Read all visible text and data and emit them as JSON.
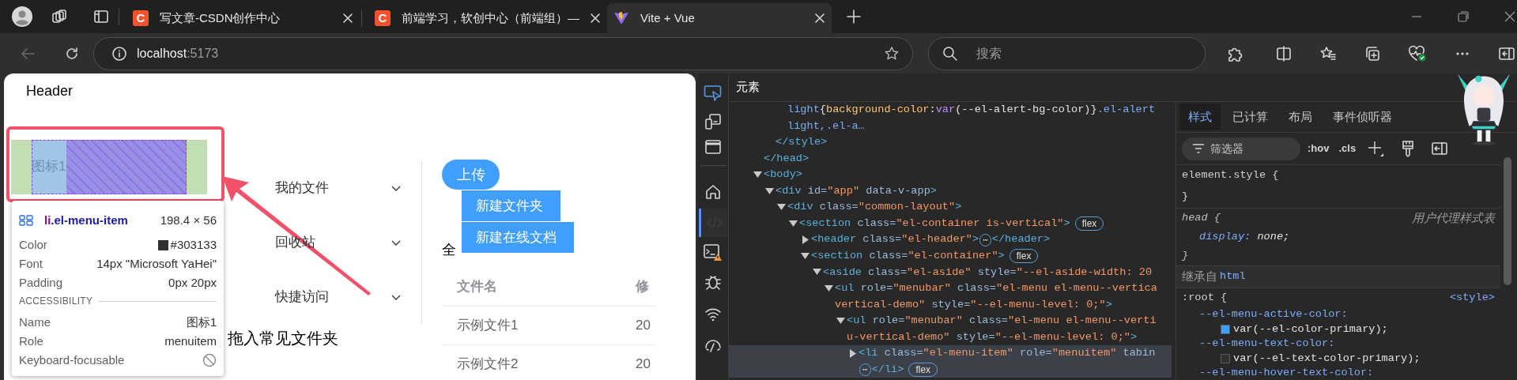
{
  "browser": {
    "tabs": [
      {
        "title": "写文章-CSDN创作中心",
        "kind": "letter",
        "icon_text": "C",
        "selected": false
      },
      {
        "title": "前端学习，软创中心（前端组）—",
        "kind": "letter",
        "icon_text": "C",
        "selected": false
      },
      {
        "title": "Vite + Vue",
        "kind": "vite",
        "selected": true
      }
    ],
    "back_disabled": true,
    "address": {
      "host": "localhost",
      "port": ":5173"
    },
    "search": {
      "placeholder": "搜索"
    }
  },
  "page": {
    "header": "Header",
    "inspected_item": {
      "label": "图标1"
    },
    "tooltip": {
      "tag": "li",
      "class_name": ".el-menu-item",
      "size": "198.4 × 56",
      "properties": [
        {
          "label": "Color",
          "value": "#303133",
          "color": "#303133"
        },
        {
          "label": "Font",
          "value": "14px \"Microsoft YaHei\""
        },
        {
          "label": "Padding",
          "value": "0px 20px"
        }
      ],
      "section": "ACCESSIBILITY",
      "accessibility": [
        {
          "label": "Name",
          "value": "图标1"
        },
        {
          "label": "Role",
          "value": "menuitem"
        },
        {
          "label": "Keyboard-focusable",
          "focusable": false
        }
      ]
    },
    "submenus": [
      {
        "label": "我的文件",
        "expanded": false
      },
      {
        "label": "回收站",
        "expanded": false
      },
      {
        "label": "快捷访问",
        "expanded": false
      }
    ],
    "drop_hint": "拖入常见文件夹",
    "upload_button": "上传",
    "dropdown": [
      "新建文件夹",
      "新建在线文档"
    ],
    "section_title": "全",
    "table": {
      "columns": [
        "文件名",
        "修"
      ],
      "rows": [
        [
          "示例文件1",
          "20"
        ],
        [
          "示例文件2",
          "20"
        ]
      ]
    }
  },
  "devtools": {
    "panel_title": "元素",
    "dom_tree": [
      {
        "children": [
          {
            "children": [
              {
                "lines": [
                  [
                    {
                      "kind": "selector",
                      "text": "light"
                    },
                    {
                      "kind": "plain",
                      "text": "{"
                    },
                    {
                      "kind": "property",
                      "text": "background-color"
                    },
                    {
                      "kind": "plain",
                      "text": ":"
                    },
                    {
                      "kind": "function",
                      "text": "var"
                    },
                    {
                      "kind": "plain",
                      "text": "(--el-alert-bg-color)}"
                    },
                    {
                      "kind": "selector",
                      "text": ".el-alert"
                    }
                  ],
                  [
                    {
                      "kind": "selector",
                      "text": "light,.el-a…"
                    }
                  ]
                ]
              }
            ]
          },
          {
            "lines": [
              [
                {
                  "kind": "tag",
                  "text": "</style>"
                }
              ]
            ]
          }
        ]
      },
      {
        "lines": [
          [
            {
              "kind": "tag",
              "text": "</head>"
            }
          ]
        ]
      },
      {
        "expanded": true,
        "lines": [
          [
            {
              "kind": "tag",
              "text": "<body>"
            }
          ]
        ],
        "children": [
          {
            "expanded": true,
            "lines": [
              [
                {
                  "kind": "tag",
                  "text": "<div"
                },
                {
                  "kind": "attr",
                  "text": " id="
                },
                {
                  "kind": "value",
                  "text": "\"app\""
                },
                {
                  "kind": "attr",
                  "text": " data-v-app"
                },
                {
                  "kind": "tag",
                  "text": ">"
                }
              ]
            ],
            "children": [
              {
                "expanded": true,
                "lines": [
                  [
                    {
                      "kind": "tag",
                      "text": "<div"
                    },
                    {
                      "kind": "attr",
                      "text": " class="
                    },
                    {
                      "kind": "value",
                      "text": "\"common-layout\""
                    },
                    {
                      "kind": "tag",
                      "text": ">"
                    }
                  ]
                ],
                "children": [
                  {
                    "expanded": true,
                    "badge": "flex",
                    "lines": [
                      [
                        {
                          "kind": "tag",
                          "text": "<section"
                        },
                        {
                          "kind": "attr",
                          "text": " class="
                        },
                        {
                          "kind": "value",
                          "text": "\"el-container is-vertical\""
                        },
                        {
                          "kind": "tag",
                          "text": ">"
                        }
                      ]
                    ],
                    "children": [
                      {
                        "expanded": false,
                        "lines": [
                          [
                            {
                              "kind": "tag",
                              "text": "<header"
                            },
                            {
                              "kind": "attr",
                              "text": " class="
                            },
                            {
                              "kind": "value",
                              "text": "\"el-header\""
                            },
                            {
                              "kind": "tag",
                              "text": ">"
                            },
                            {
                              "kind": "ellipsis",
                              "text": "⋯"
                            },
                            {
                              "kind": "tag",
                              "text": "</header>"
                            }
                          ]
                        ]
                      },
                      {
                        "expanded": true,
                        "badge": "flex",
                        "lines": [
                          [
                            {
                              "kind": "tag",
                              "text": "<section"
                            },
                            {
                              "kind": "attr",
                              "text": " class="
                            },
                            {
                              "kind": "value",
                              "text": "\"el-container\""
                            },
                            {
                              "kind": "tag",
                              "text": ">"
                            }
                          ]
                        ],
                        "children": [
                          {
                            "expanded": true,
                            "lines": [
                              [
                                {
                                  "kind": "tag",
                                  "text": "<aside"
                                },
                                {
                                  "kind": "attr",
                                  "text": " class="
                                },
                                {
                                  "kind": "value",
                                  "text": "\"el-aside\""
                                },
                                {
                                  "kind": "attr",
                                  "text": " style="
                                },
                                {
                                  "kind": "value",
                                  "text": "\"--el-aside-width: 20"
                                }
                              ]
                            ],
                            "children": [
                              {
                                "expanded": true,
                                "lines": [
                                  [
                                    {
                                      "kind": "tag",
                                      "text": "<ul"
                                    },
                                    {
                                      "kind": "attr",
                                      "text": " role="
                                    },
                                    {
                                      "kind": "value",
                                      "text": "\"menubar\""
                                    },
                                    {
                                      "kind": "attr",
                                      "text": " class="
                                    },
                                    {
                                      "kind": "value",
                                      "text": "\"el-menu el-menu--vertica"
                                    }
                                  ],
                                  [
                                    {
                                      "kind": "value",
                                      "text": "vertical-demo\""
                                    },
                                    {
                                      "kind": "attr",
                                      "text": " style="
                                    },
                                    {
                                      "kind": "value",
                                      "text": "\"--el-menu-level: 0;\""
                                    },
                                    {
                                      "kind": "tag",
                                      "text": ">"
                                    }
                                  ]
                                ],
                                "children": [
                                  {
                                    "expanded": true,
                                    "lines": [
                                      [
                                        {
                                          "kind": "tag",
                                          "text": "<ul"
                                        },
                                        {
                                          "kind": "attr",
                                          "text": " role="
                                        },
                                        {
                                          "kind": "value",
                                          "text": "\"menubar\""
                                        },
                                        {
                                          "kind": "attr",
                                          "text": " class="
                                        },
                                        {
                                          "kind": "value",
                                          "text": "\"el-menu el-menu--verti"
                                        }
                                      ],
                                      [
                                        {
                                          "kind": "value",
                                          "text": "u-vertical-demo\""
                                        },
                                        {
                                          "kind": "attr",
                                          "text": " style="
                                        },
                                        {
                                          "kind": "value",
                                          "text": "\"--el-menu-level: 0;\""
                                        },
                                        {
                                          "kind": "tag",
                                          "text": ">"
                                        }
                                      ]
                                    ],
                                    "children": [
                                      {
                                        "expanded": false,
                                        "selected": true,
                                        "badge": "flex",
                                        "lines": [
                                          [
                                            {
                                              "kind": "tag",
                                              "text": "<li"
                                            },
                                            {
                                              "kind": "attr",
                                              "text": " class="
                                            },
                                            {
                                              "kind": "value",
                                              "text": "\"el-menu-item\""
                                            },
                                            {
                                              "kind": "attr",
                                              "text": " role="
                                            },
                                            {
                                              "kind": "value",
                                              "text": "\"menuitem\""
                                            },
                                            {
                                              "kind": "attr",
                                              "text": " tabin"
                                            }
                                          ],
                                          [
                                            {
                                              "kind": "ellipsis",
                                              "text": "⋯"
                                            },
                                            {
                                              "kind": "tag",
                                              "text": "</li>"
                                            }
                                          ]
                                        ]
                                      }
                                    ]
                                  }
                                ]
                              }
                            ]
                          }
                        ]
                      }
                    ]
                  }
                ]
              }
            ]
          }
        ]
      }
    ],
    "styles": {
      "tabs": [
        {
          "label": "样式",
          "selected": true
        },
        {
          "label": "已计算",
          "selected": false
        },
        {
          "label": "布局",
          "selected": false
        },
        {
          "label": "事件侦听器",
          "selected": false
        }
      ],
      "filter": {
        "placeholder": "筛选器"
      },
      "toggles": [
        ":hov",
        ".cls"
      ],
      "sections": [
        {
          "kind": "rule",
          "open": "element.style {",
          "close": "}"
        },
        {
          "kind": "user_agent",
          "open": "head {",
          "source": "用户代理样式表",
          "close": "}",
          "declarations": [
            {
              "property": "display:",
              "value": "none;"
            }
          ]
        },
        {
          "kind": "inherited",
          "label": "继承自",
          "link": "html"
        },
        {
          "kind": "rule",
          "open": ":root {",
          "source": "<style>",
          "declarations": [
            {
              "property": "--el-menu-active-color:",
              "value": "var(--el-color-primary);",
              "color": "#409eff"
            },
            {
              "property": "--el-menu-text-color:",
              "value": "var(--el-text-color-primary);",
              "color": "#303133"
            },
            {
              "property": "--el-menu-hover-text-color:"
            }
          ]
        }
      ]
    }
  }
}
